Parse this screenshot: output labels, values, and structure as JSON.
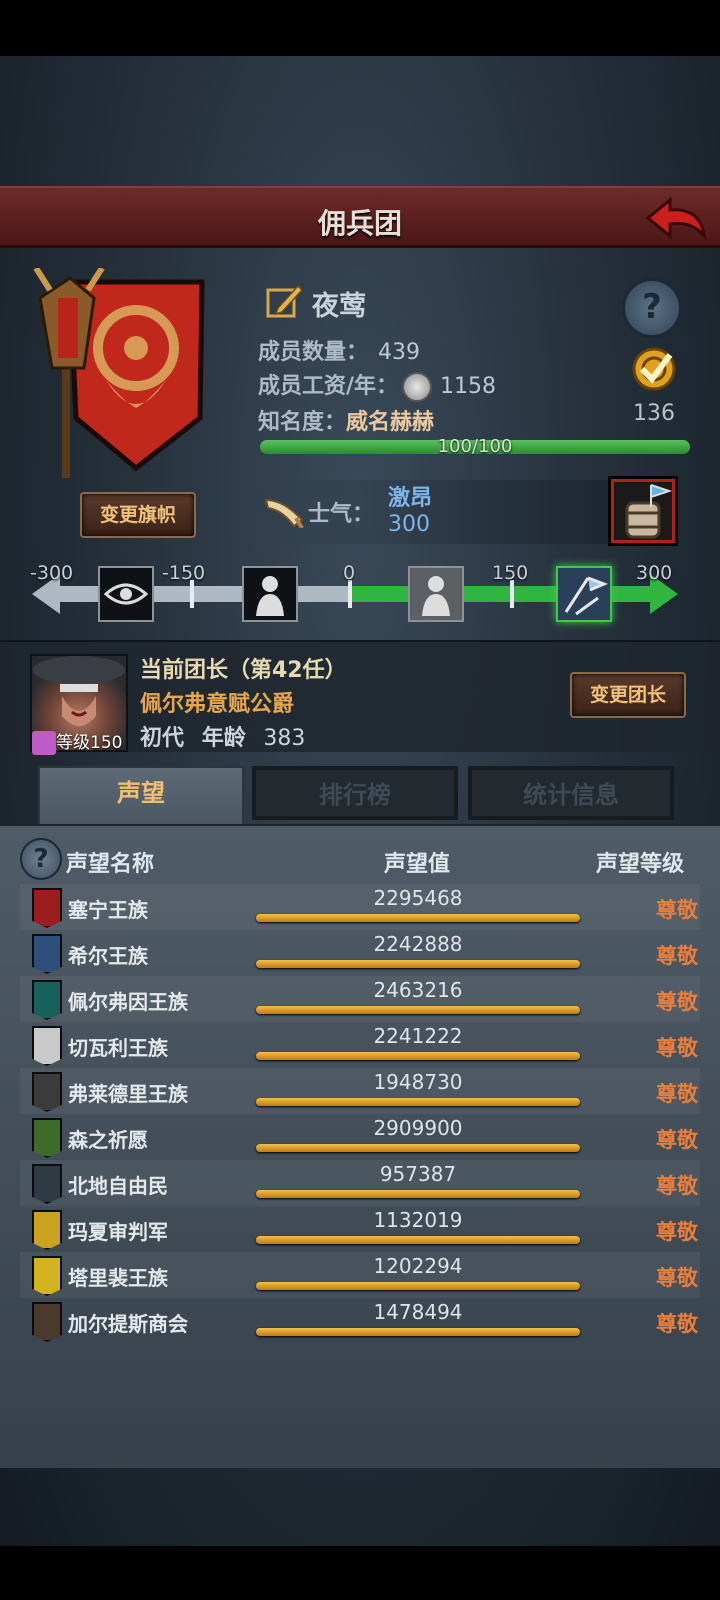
{
  "header": {
    "title": "佣兵团"
  },
  "company": {
    "name": "夜莺",
    "members_label": "成员数量：",
    "members": "439",
    "wage_label": "成员工资/年：",
    "wage": "1158",
    "fame_label": "知名度：",
    "fame_status": "威名赫赫",
    "fame_progress": "100/100",
    "fame_fraction": 1.0,
    "badge_count": "136",
    "morale_label": "士气：",
    "morale_status": "激昂",
    "morale_value": "300",
    "change_flag": "变更旗帜"
  },
  "morale_track": {
    "ticks": [
      "-300",
      "-150",
      "0",
      "150",
      "300"
    ],
    "tiles": [
      {
        "icon": "eye-icon",
        "active": false
      },
      {
        "icon": "despair-icon",
        "active": false
      },
      {
        "icon": "calm-icon",
        "active": false
      },
      {
        "icon": "charge-icon",
        "active": true
      }
    ]
  },
  "leader": {
    "title": "当前团长（第42任）",
    "name": "佩尔弗意赋公爵",
    "level": "等级150",
    "generation": "初代",
    "age_label": "年龄",
    "age": "383",
    "change_leader": "变更团长"
  },
  "tabs": [
    {
      "label": "声望",
      "active": true
    },
    {
      "label": "排行榜",
      "active": false
    },
    {
      "label": "统计信息",
      "active": false
    }
  ],
  "reputation": {
    "headers": {
      "name": "声望名称",
      "value": "声望值",
      "level": "声望等级"
    },
    "rows": [
      {
        "name": "塞宁王族",
        "value": "2295468",
        "level": "尊敬",
        "color": "#9c1d1d"
      },
      {
        "name": "希尔王族",
        "value": "2242888",
        "level": "尊敬",
        "color": "#2d4f7a"
      },
      {
        "name": "佩尔弗因王族",
        "value": "2463216",
        "level": "尊敬",
        "color": "#17605c"
      },
      {
        "name": "切瓦利王族",
        "value": "2241222",
        "level": "尊敬",
        "color": "#c9c9c9"
      },
      {
        "name": "弗莱德里王族",
        "value": "1948730",
        "level": "尊敬",
        "color": "#3b3b3b"
      },
      {
        "name": "森之祈愿",
        "value": "2909900",
        "level": "尊敬",
        "color": "#3e6b2a"
      },
      {
        "name": "北地自由民",
        "value": "957387",
        "level": "尊敬",
        "color": "#2e3a44"
      },
      {
        "name": "玛夏审判军",
        "value": "1132019",
        "level": "尊敬",
        "color": "#c9a21f"
      },
      {
        "name": "塔里裴王族",
        "value": "1202294",
        "level": "尊敬",
        "color": "#d2b21f"
      },
      {
        "name": "加尔提斯商会",
        "value": "1478494",
        "level": "尊敬",
        "color": "#4a3a2c"
      }
    ]
  },
  "colors": {
    "accent": "#f0c070",
    "level": "#e87e3c",
    "morale": "#7fb4e8"
  }
}
